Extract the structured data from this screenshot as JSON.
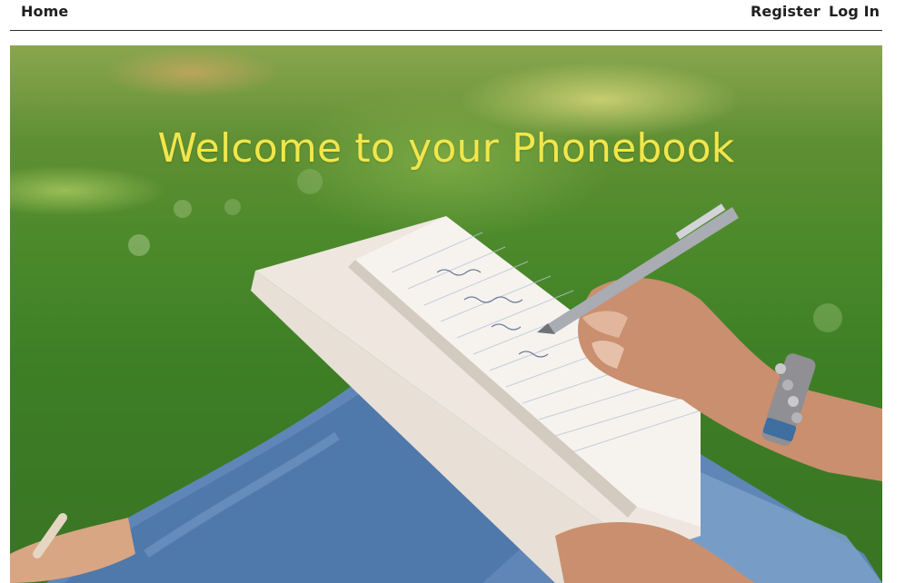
{
  "nav": {
    "home_label": "Home",
    "register_label": "Register",
    "login_label": "Log In"
  },
  "hero": {
    "title": "Welcome to your Phonebook",
    "title_color": "#f2e64a",
    "image_subject": "person-writing-in-notebook-on-grass"
  }
}
